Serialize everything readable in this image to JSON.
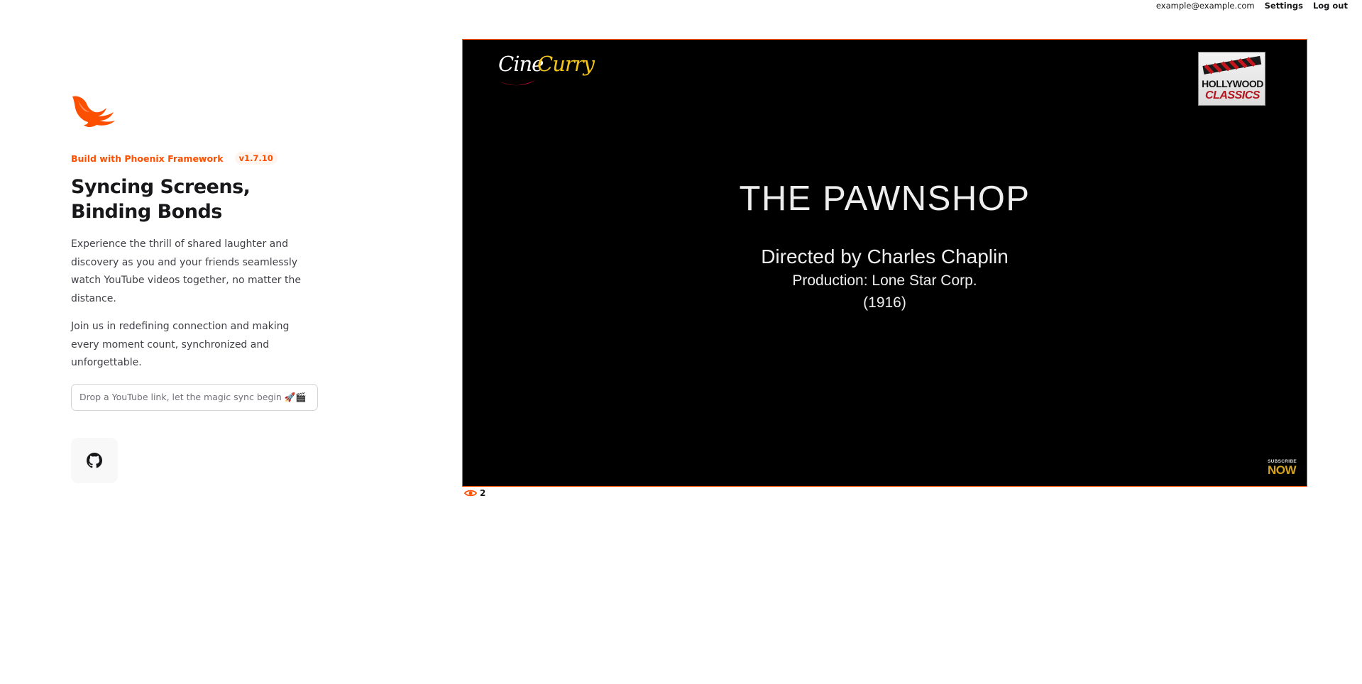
{
  "account": {
    "email": "example@example.com",
    "settings_label": "Settings",
    "logout_label": "Log out"
  },
  "hero": {
    "framework_label": "Build with Phoenix Framework",
    "version": "v1.7.10",
    "headline": "Syncing Screens, Binding Bonds",
    "paragraph_1": "Experience the thrill of shared laughter and discovery as you and your friends seamlessly watch YouTube videos together, no matter the distance.",
    "paragraph_2": "Join us in redefining connection and making every moment count, synchronized and unforgettable.",
    "input_placeholder": "Drop a YouTube link, let the magic sync begin 🚀🎬",
    "input_value": ""
  },
  "video": {
    "logo_left_part1": "Cine",
    "logo_left_part2": "Curry",
    "logo_right_line1": "HOLLYWOOD",
    "logo_right_line2": "CLASSICS",
    "title": "THE PAWNSHOP",
    "director": "Directed by Charles Chaplin",
    "production": "Production: Lone Star Corp.",
    "year": "(1916)",
    "subscribe_small": "SUBSCRIBE",
    "subscribe_big": "NOW"
  },
  "viewers": {
    "count": "2",
    "icon": "eye-icon"
  },
  "colors": {
    "accent": "#fd4f00",
    "text": "#18181b",
    "muted": "#3f3f46"
  }
}
